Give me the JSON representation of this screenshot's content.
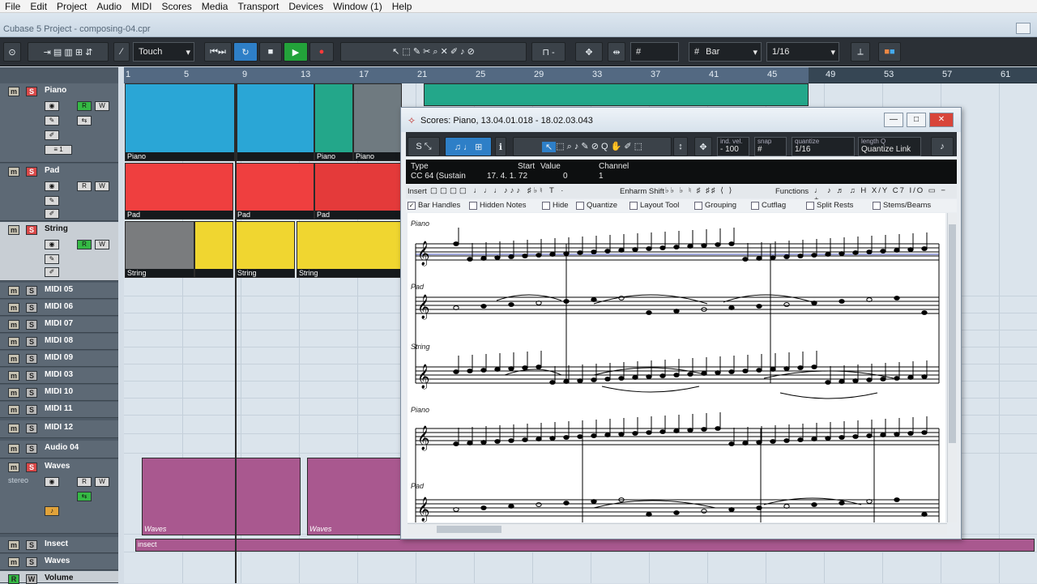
{
  "menu": [
    "File",
    "Edit",
    "Project",
    "Audio",
    "MIDI",
    "Scores",
    "Media",
    "Transport",
    "Devices",
    "Window (1)",
    "Help"
  ],
  "window_title": "Cubase 5 Project - composing-04.cpr",
  "toolbar": {
    "automation_mode": "Touch",
    "grid_type": "Bar",
    "quantize": "1/16"
  },
  "ruler": [
    "1",
    "5",
    "9",
    "13",
    "17",
    "21",
    "25",
    "29",
    "33",
    "37",
    "41",
    "45",
    "49",
    "53",
    "57",
    "61"
  ],
  "tracks": [
    {
      "name": "Piano",
      "solo_active": true
    },
    {
      "name": "Pad",
      "solo_active": true
    },
    {
      "name": "String",
      "solo_active": true
    },
    {
      "name": "MIDI 05"
    },
    {
      "name": "MIDI 06"
    },
    {
      "name": "MIDI 07"
    },
    {
      "name": "MIDI 08"
    },
    {
      "name": "MIDI 09"
    },
    {
      "name": "MIDI 03"
    },
    {
      "name": "MIDI 10"
    },
    {
      "name": "MIDI 11"
    },
    {
      "name": "MIDI 12"
    },
    {
      "name": "Audio 04"
    },
    {
      "name": "Waves",
      "solo_active": true,
      "sub": "stereo"
    },
    {
      "name": "Insect"
    },
    {
      "name": "Waves"
    },
    {
      "name": "Volume"
    }
  ],
  "parts": {
    "piano": "Piano",
    "pad": "Pad",
    "string": "String",
    "waves": "Waves",
    "insect": "insect"
  },
  "score": {
    "title": "Scores: Piano, 13.04.01.018 - 18.02.03.043",
    "ind_vel_label": "ind. vel.",
    "ind_vel_value": "- 100",
    "snap_label": "snap",
    "quantize_label": "quantize",
    "quantize_value": "1/16",
    "length_label": "length Q",
    "length_value": "Quantize Link",
    "info_headers": [
      "Type",
      "Start",
      "Value",
      "Channel"
    ],
    "info_values": [
      "CC 64  (Sustain",
      "17. 4. 1. 72",
      "0",
      "1"
    ],
    "insert_label": "Insert",
    "enharm_label": "Enharm Shift",
    "functions_label": "Functions",
    "options": [
      "Bar Handles",
      "Hidden Notes",
      "Hide",
      "Quantize",
      "Layout Tool",
      "Grouping",
      "Cutflag",
      "Split Rests",
      "Stems/Beams"
    ],
    "staff_labels": [
      "Piano",
      "Pad",
      "String",
      "Piano",
      "Pad"
    ]
  }
}
